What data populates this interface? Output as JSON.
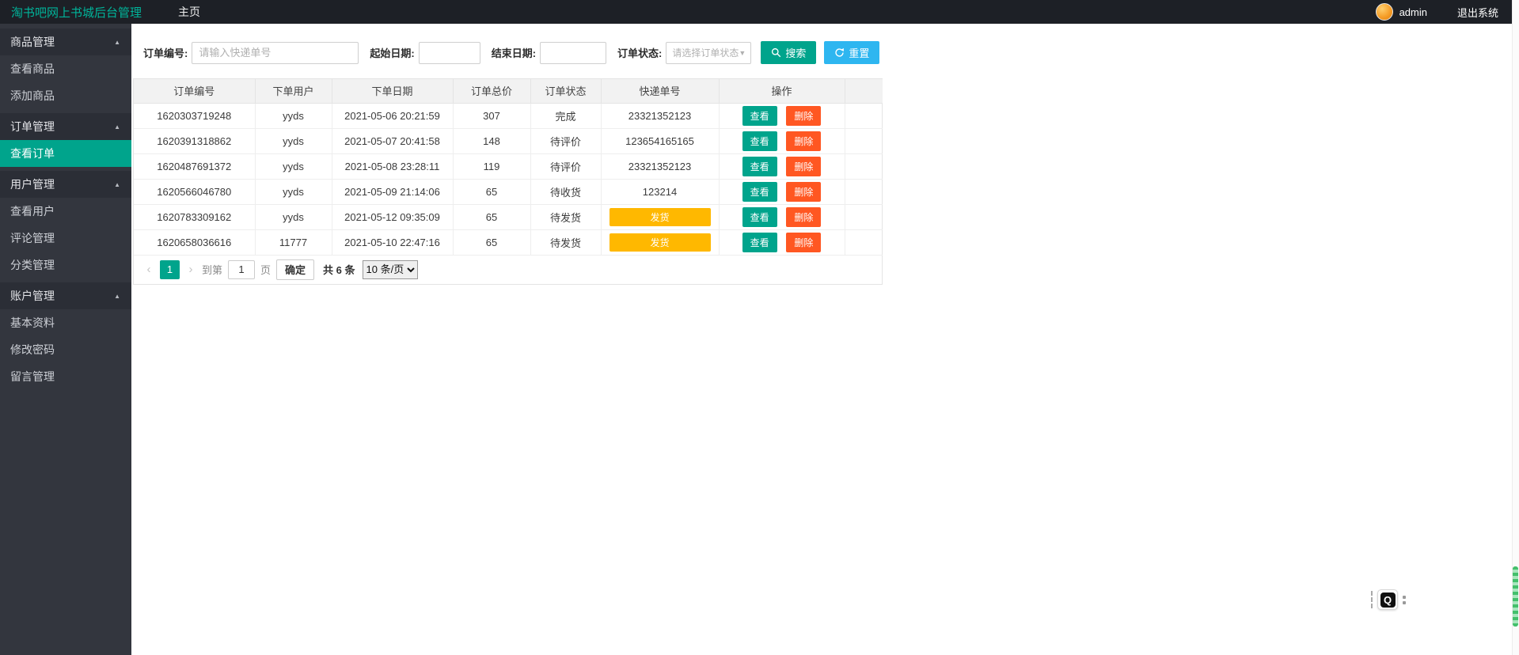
{
  "header": {
    "title": "淘书吧网上书城后台管理",
    "home": "主页",
    "username": "admin",
    "logout": "退出系统"
  },
  "sidebar": {
    "items": [
      {
        "label": "商品管理",
        "type": "group"
      },
      {
        "label": "查看商品",
        "type": "item"
      },
      {
        "label": "添加商品",
        "type": "item"
      },
      {
        "label": "订单管理",
        "type": "group"
      },
      {
        "label": "查看订单",
        "type": "item",
        "active": true
      },
      {
        "label": "用户管理",
        "type": "group"
      },
      {
        "label": "查看用户",
        "type": "item"
      },
      {
        "label": "评论管理",
        "type": "item"
      },
      {
        "label": "分类管理",
        "type": "item"
      },
      {
        "label": "账户管理",
        "type": "group"
      },
      {
        "label": "基本资料",
        "type": "item"
      },
      {
        "label": "修改密码",
        "type": "item"
      },
      {
        "label": "留言管理",
        "type": "item"
      }
    ]
  },
  "filter": {
    "order_no_label": "订单编号:",
    "order_no_placeholder": "请输入快递单号",
    "start_date_label": "起始日期:",
    "end_date_label": "结束日期:",
    "status_label": "订单状态:",
    "status_placeholder": "请选择订单状态",
    "search_button": "搜索",
    "reset_button": "重置"
  },
  "table": {
    "headers": [
      "订单编号",
      "下单用户",
      "下单日期",
      "订单总价",
      "订单状态",
      "快递单号",
      "操作"
    ],
    "view_button": "查看",
    "delete_button": "删除",
    "ship_button": "发货",
    "rows": [
      {
        "order_no": "1620303719248",
        "user": "yyds",
        "date": "2021-05-06 20:21:59",
        "total": "307",
        "status": "完成",
        "tracking": "23321352123"
      },
      {
        "order_no": "1620391318862",
        "user": "yyds",
        "date": "2021-05-07 20:41:58",
        "total": "148",
        "status": "待评价",
        "tracking": "123654165165"
      },
      {
        "order_no": "1620487691372",
        "user": "yyds",
        "date": "2021-05-08 23:28:11",
        "total": "119",
        "status": "待评价",
        "tracking": "23321352123"
      },
      {
        "order_no": "1620566046780",
        "user": "yyds",
        "date": "2021-05-09 21:14:06",
        "total": "65",
        "status": "待收货",
        "tracking": "123214"
      },
      {
        "order_no": "1620783309162",
        "user": "yyds",
        "date": "2021-05-12 09:35:09",
        "total": "65",
        "status": "待发货",
        "tracking": ""
      },
      {
        "order_no": "1620658036616",
        "user": "11777",
        "date": "2021-05-10 22:47:16",
        "total": "65",
        "status": "待发货",
        "tracking": ""
      }
    ]
  },
  "pagination": {
    "current_page": "1",
    "goto_label": "到第",
    "goto_value": "1",
    "page_unit": "页",
    "confirm_button": "确定",
    "total_text": "共 6 条",
    "page_size": "10 条/页"
  },
  "ime": {
    "icon_label": "Q"
  },
  "colors": {
    "accent_teal": "#00a48c",
    "reset_blue": "#2eb6f0",
    "delete_red": "#ff5722",
    "ship_yellow": "#ffb800",
    "header_bg": "#1d2026",
    "sidebar_bg": "#33363e"
  }
}
